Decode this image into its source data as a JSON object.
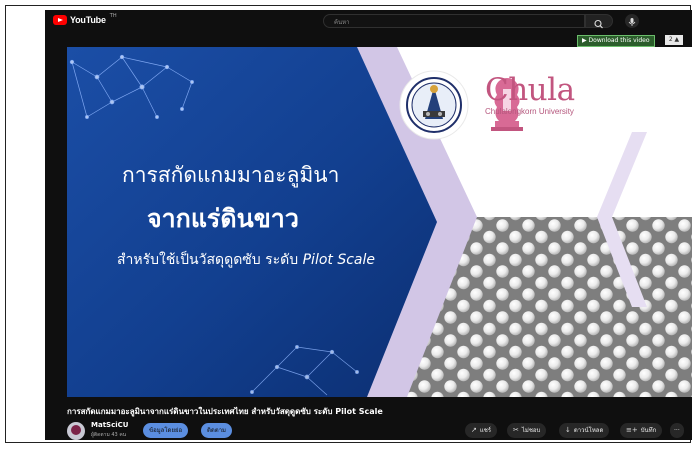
{
  "app": {
    "logo_text": "YouTube",
    "logo_sup": "TH",
    "search_placeholder": "ค้นหา"
  },
  "toolbar": {
    "download_label": "▶ Download this video",
    "download_extra": "2 ▲"
  },
  "video": {
    "thumbnail": {
      "line1": "การสกัดแกมมาอะลูมินา",
      "line2": "จากแร่ดินขาว",
      "line3_th": "สำหรับใช้เป็นวัสดุดูดซับ ระดับ ",
      "line3_en": "Pilot Scale",
      "brand_name": "Chula",
      "brand_sub": "Chulalongkorn University"
    },
    "title": "การสกัดแกมมาอะลูมินาจากแร่ดินขาวในประเทศไทย สำหรับวัสดุดูดซับ ระดับ Pilot Scale"
  },
  "channel": {
    "name": "MatSciCU",
    "subscribers": "ผู้ติดตาม 43 คน",
    "join_label": "ข้อมูลโดยย่อ",
    "subscribe_label": "ติดตาม"
  },
  "actions": {
    "share": "แชร์",
    "clip": "ไม่ชอบ",
    "download": "ดาวน์โหลด",
    "save": "บันทึก",
    "more": "···"
  },
  "colors": {
    "brand_red": "#ff0000",
    "panel_blue": "#123f8f",
    "chula_pink": "#c2557f",
    "button_blue": "#5b8ee0"
  }
}
